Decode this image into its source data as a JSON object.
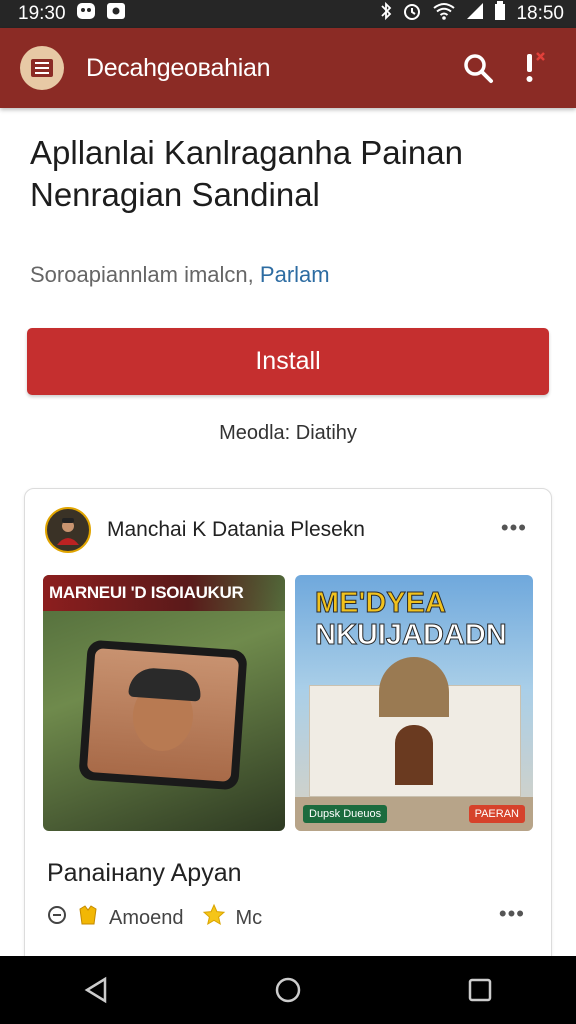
{
  "status_bar": {
    "time_left": "19:30",
    "time_right": "18:50"
  },
  "app_bar": {
    "title": "Decahgeoвahian",
    "icons": [
      "menu-logo-icon",
      "search-icon",
      "alert-icon"
    ]
  },
  "main": {
    "headline": "Apllanlai Kanlraganha Painan Nenragian Sandinal",
    "subline_text": "Soroapiannlam imalcn,",
    "subline_link": "Parlam",
    "install_label": "Install",
    "meta_text": "Meodla: Diatihy"
  },
  "card": {
    "header_title": "Manchai  K  Datania Plesekn",
    "more_label": "•••",
    "thumb_left_caption": "MARNEUI 'D ISOIAUKUR",
    "thumb_right_caption_line1": "ME'DYEA",
    "thumb_right_caption_line2": "NKUIJADADN",
    "thumb_right_badge_left": "Dupsk Dueuos",
    "thumb_right_badge_right": "PAERAN",
    "item_title": "Panaiнany Apyan",
    "meta_label_1": "Amoend",
    "meta_label_2": "Mc"
  },
  "colors": {
    "app_bar": "#8b2b25",
    "install_button": "#c52f2f",
    "link": "#2d6ca2"
  }
}
